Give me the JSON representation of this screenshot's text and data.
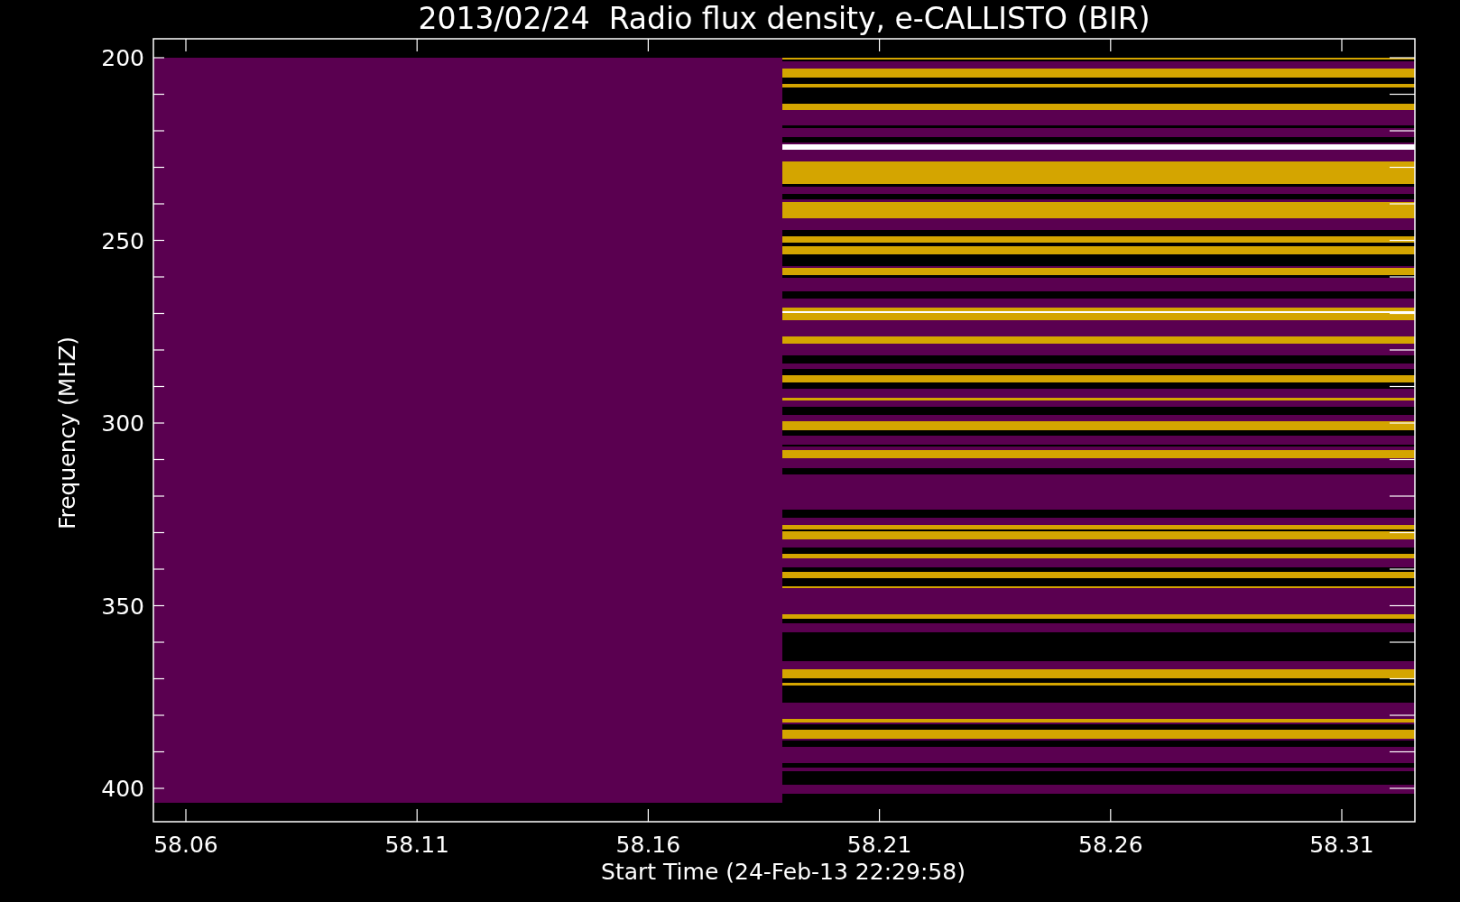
{
  "title": "2013/02/24  Radio flux density, e-CALLISTO (BIR)",
  "y_axis": {
    "label": "Frequency (MHZ)",
    "ticks": [
      "200",
      "250",
      "300",
      "350",
      "400"
    ]
  },
  "x_axis": {
    "label": "Start Time (24-Feb-13 22:29:58)",
    "ticks": [
      "58.06",
      "58.11",
      "58.16",
      "58.21",
      "58.26",
      "58.31"
    ]
  }
}
